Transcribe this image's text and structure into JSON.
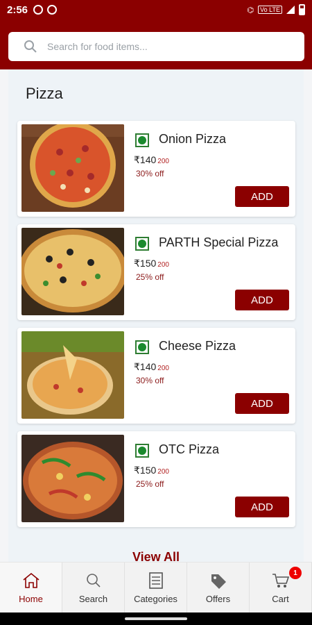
{
  "status_bar": {
    "time": "2:56",
    "lte": "Vo LTE"
  },
  "search": {
    "placeholder": "Search for food items..."
  },
  "section": {
    "title": "Pizza"
  },
  "items": [
    {
      "name": "Onion Pizza",
      "price": "₹140",
      "old_price": "200",
      "discount": "30% off",
      "add_label": "ADD"
    },
    {
      "name": "PARTH Special Pizza",
      "price": "₹150",
      "old_price": "200",
      "discount": "25% off",
      "add_label": "ADD"
    },
    {
      "name": "Cheese Pizza",
      "price": "₹140",
      "old_price": "200",
      "discount": "30% off",
      "add_label": "ADD"
    },
    {
      "name": "OTC Pizza",
      "price": "₹150",
      "old_price": "200",
      "discount": "25% off",
      "add_label": "ADD"
    }
  ],
  "view_all": "View All",
  "nav": {
    "home": "Home",
    "search": "Search",
    "categories": "Categories",
    "offers": "Offers",
    "cart": "Cart",
    "cart_count": "1"
  },
  "colors": {
    "brand": "#8b0000",
    "veg_green": "#1b8a2e"
  }
}
